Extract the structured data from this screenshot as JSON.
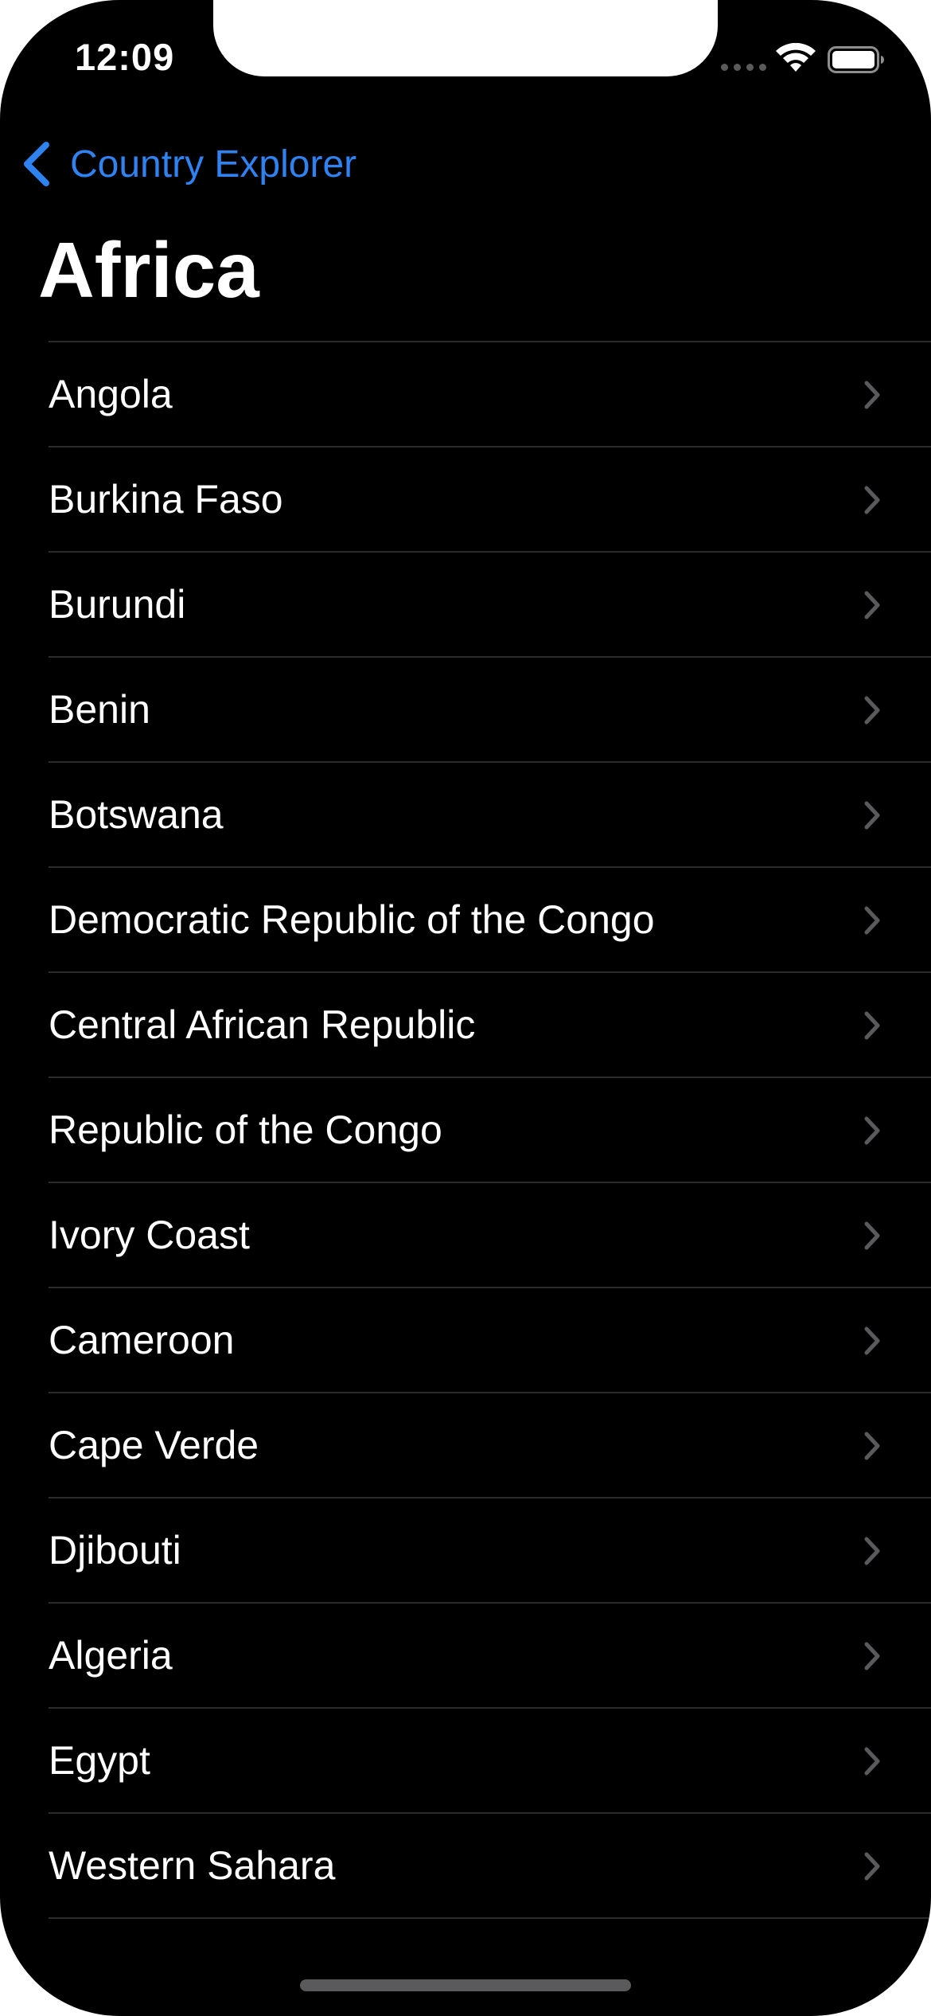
{
  "status_bar": {
    "time": "12:09",
    "icons": [
      "signal-dots-icon",
      "wifi-icon",
      "battery-icon"
    ]
  },
  "nav": {
    "back_label": "Country Explorer",
    "back_icon": "chevron-left-icon",
    "title": "Africa"
  },
  "colors": {
    "background": "#000000",
    "accent": "#2f83f0",
    "text": "#ffffff",
    "separator": "#2a2a2c",
    "chevron": "#5a5a5c"
  },
  "countries": [
    "Angola",
    "Burkina Faso",
    "Burundi",
    "Benin",
    "Botswana",
    "Democratic Republic of the Congo",
    "Central African Republic",
    "Republic of the Congo",
    "Ivory Coast",
    "Cameroon",
    "Cape Verde",
    "Djibouti",
    "Algeria",
    "Egypt",
    "Western Sahara"
  ],
  "row_icon": "chevron-right-icon"
}
